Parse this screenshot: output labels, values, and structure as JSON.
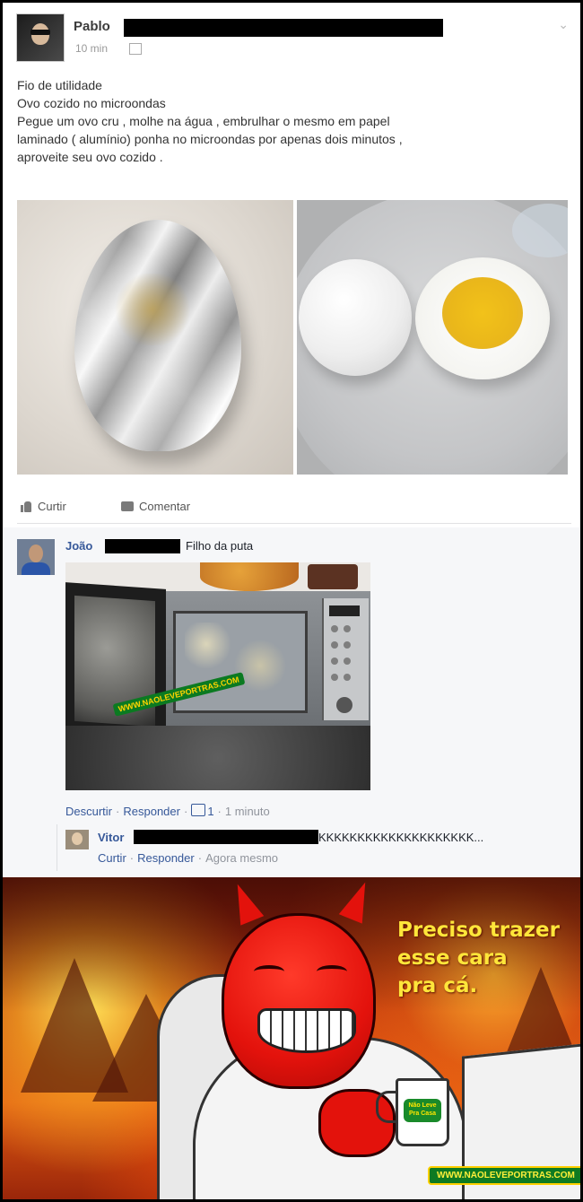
{
  "post": {
    "author": "Pablo",
    "time": "10 min",
    "text_lines": [
      "Fio de utilidade",
      "Ovo cozido no microondas",
      "Pegue um ovo cru , molhe na água , embrulhar o mesmo em papel",
      "laminado ( alumínio) ponha no microondas por apenas dois minutos ,",
      "aproveite seu ovo cozido ."
    ],
    "actions": {
      "like": "Curtir",
      "comment": "Comentar"
    }
  },
  "comment1": {
    "author": "João",
    "text": "Filho da puta",
    "meta": {
      "unlike": "Descurtir",
      "reply": "Responder",
      "likes": "1",
      "time": "1 minuto"
    },
    "image_watermark": "WWW.NAOLEVEPORTRAS.COM"
  },
  "comment2": {
    "author": "Vitor",
    "text": "KKKKKKKKKKKKKKKKKKKK...",
    "meta": {
      "like": "Curtir",
      "reply": "Responder",
      "time": "Agora mesmo"
    }
  },
  "meme": {
    "caption_lines": [
      "Preciso trazer",
      "esse cara",
      "pra cá."
    ],
    "mug_logo": "Não Leve Pra Casa",
    "watermark": "WWW.NAOLEVEPORTRAS.COM"
  },
  "colors": {
    "link": "#365899",
    "caption": "#ffe63a",
    "censor": "#000000"
  },
  "icons": [
    "like-icon",
    "comment-icon",
    "clock-icon",
    "chevron-down-icon"
  ]
}
